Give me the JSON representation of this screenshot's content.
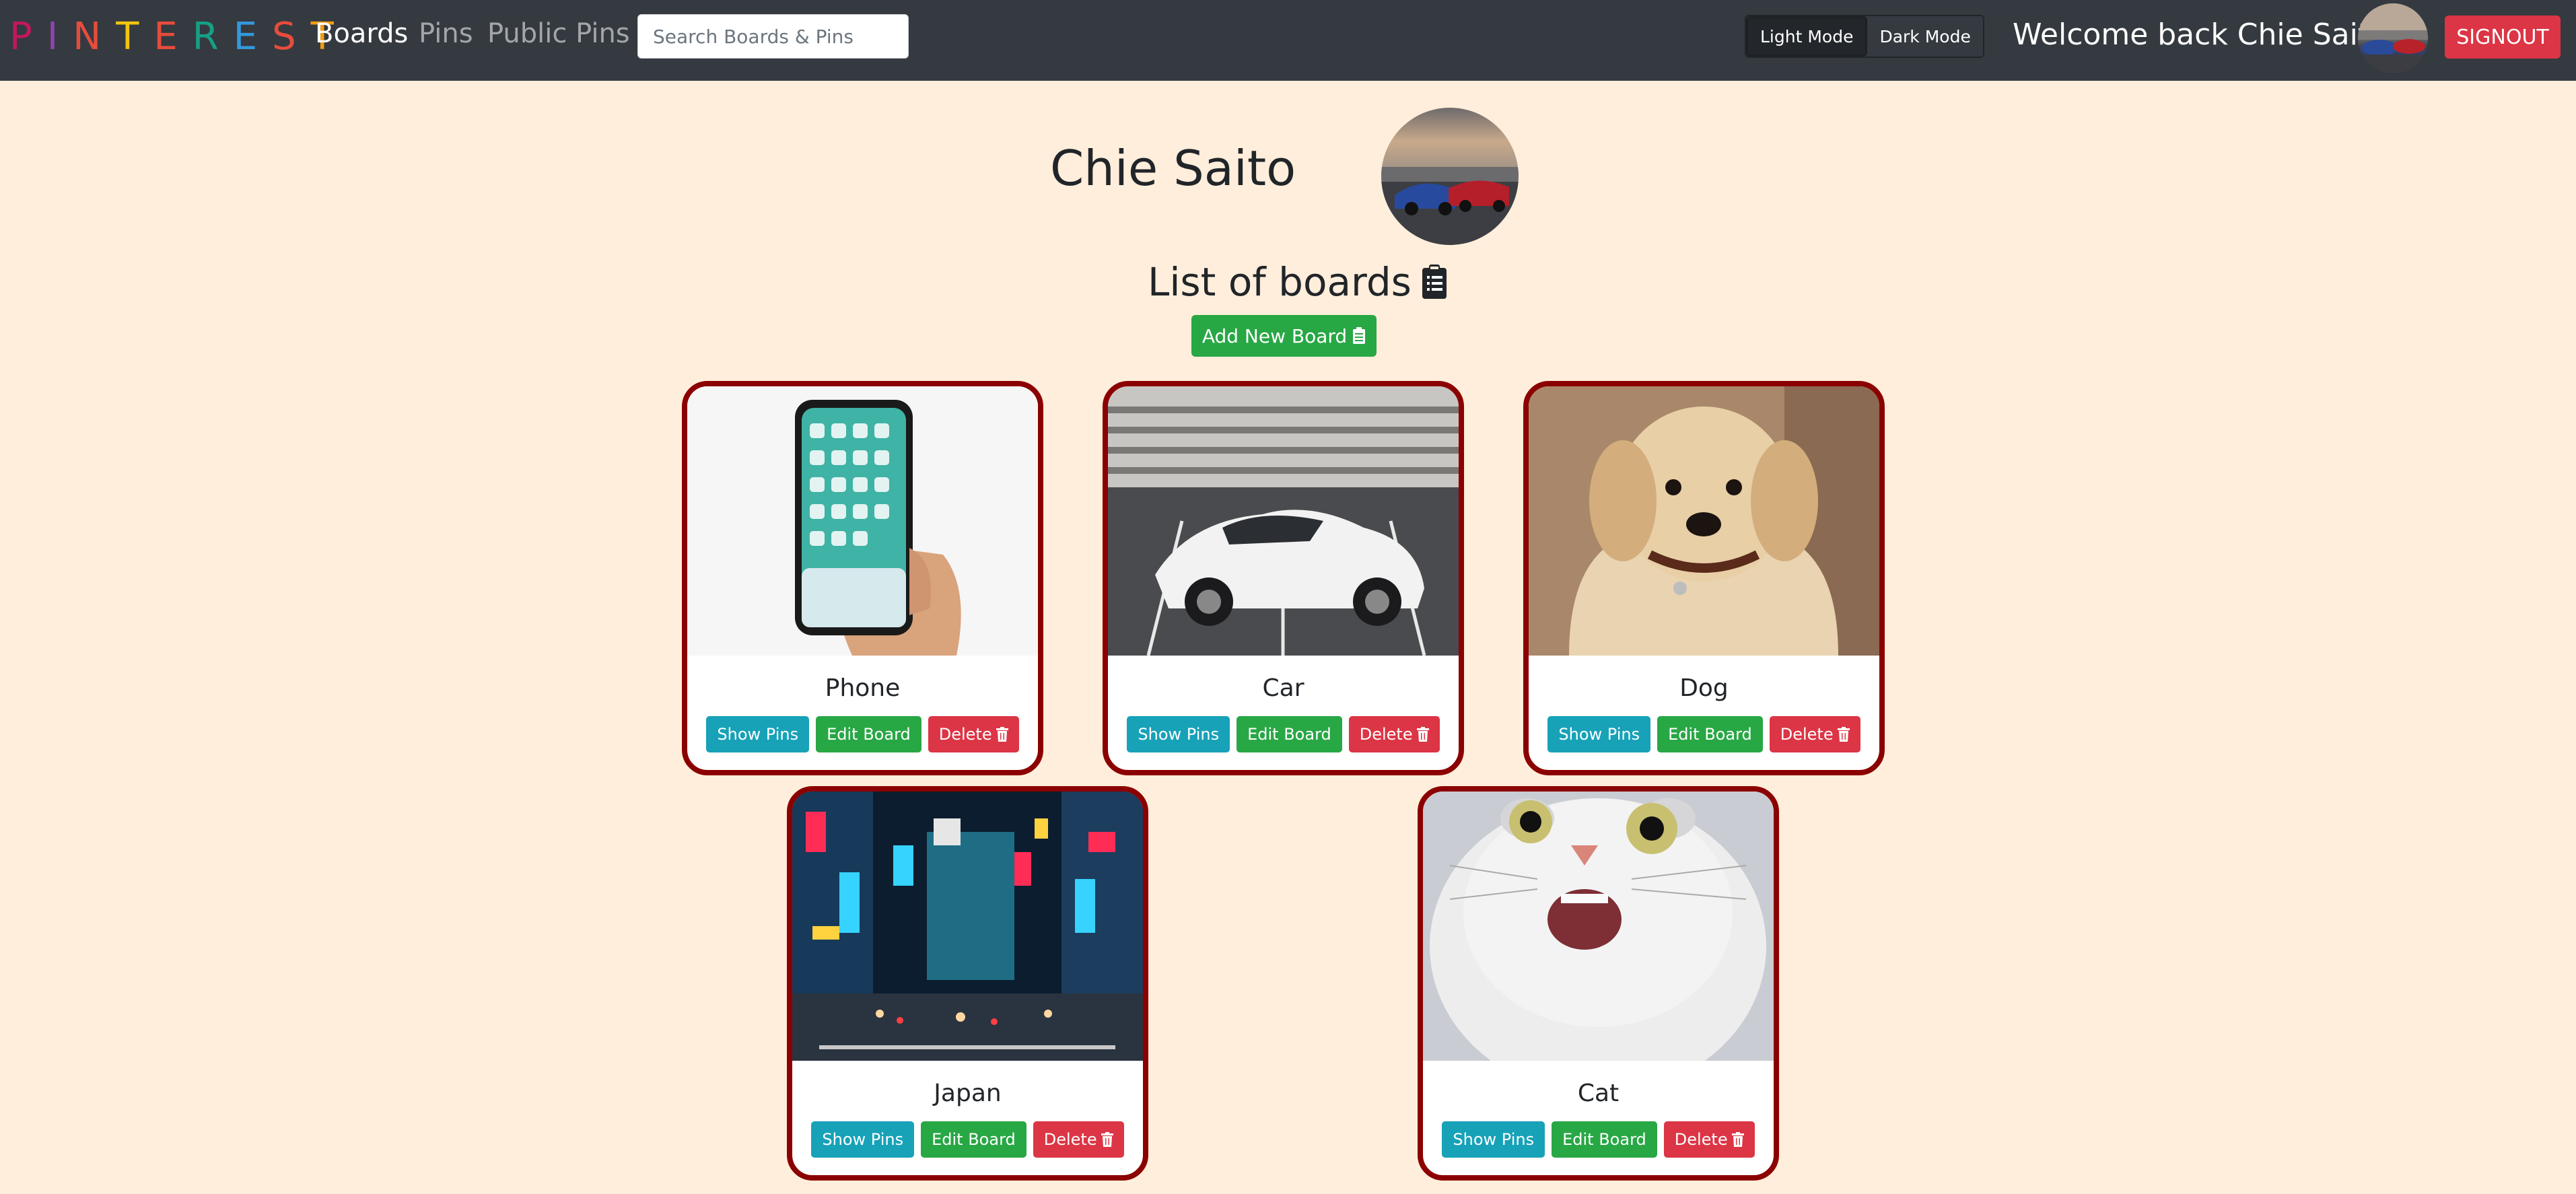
{
  "nav": {
    "brand_letters": [
      {
        "char": "P",
        "color": "#c2185b"
      },
      {
        "char": "I",
        "color": "#8e44ad"
      },
      {
        "char": "N",
        "color": "#e74c3c"
      },
      {
        "char": "T",
        "color": "#f1c40f"
      },
      {
        "char": "E",
        "color": "#e74c3c"
      },
      {
        "char": "R",
        "color": "#16a085"
      },
      {
        "char": "E",
        "color": "#3498db"
      },
      {
        "char": "S",
        "color": "#e74c3c"
      },
      {
        "char": "T",
        "color": "#f39c12"
      }
    ],
    "links": [
      "Boards",
      "Pins",
      "Public Pins"
    ],
    "search_placeholder": "Search Boards & Pins",
    "light_mode": "Light Mode",
    "dark_mode": "Dark Mode",
    "welcome": "Welcome back Chie Saito",
    "signout": "SIGNOUT"
  },
  "profile": {
    "name": "Chie Saito",
    "list_title": "List of boards",
    "add_board": "Add New Board"
  },
  "boards": [
    {
      "title": "Phone",
      "show": "Show Pins",
      "edit": "Edit Board",
      "delete": "Delete"
    },
    {
      "title": "Car",
      "show": "Show Pins",
      "edit": "Edit Board",
      "delete": "Delete"
    },
    {
      "title": "Dog",
      "show": "Show Pins",
      "edit": "Edit Board",
      "delete": "Delete"
    },
    {
      "title": "Japan",
      "show": "Show Pins",
      "edit": "Edit Board",
      "delete": "Delete"
    },
    {
      "title": "Cat",
      "show": "Show Pins",
      "edit": "Edit Board",
      "delete": "Delete"
    }
  ],
  "colors": {
    "background": "#ffeedb",
    "navbar": "#343a40",
    "card_border": "#8b0000",
    "info": "#17a2b8",
    "success": "#28a745",
    "danger": "#dc3545"
  }
}
